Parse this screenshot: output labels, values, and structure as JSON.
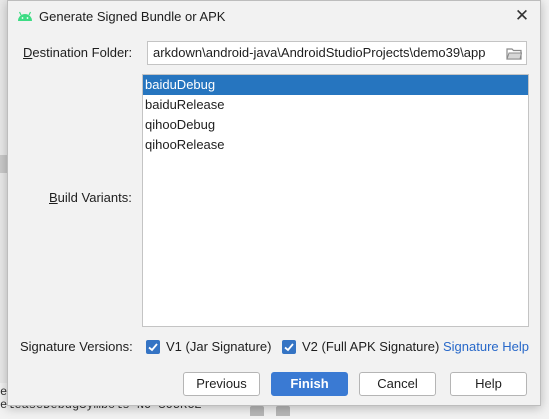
{
  "background": {
    "console_line_1": "e",
    "console_line_2": "eleaseDebugSymbols NO-SOURCE"
  },
  "dialog": {
    "title": "Generate Signed Bundle or APK",
    "close_label": "✕",
    "destination_label_mnemonic": "D",
    "destination_label_rest": "estination Folder:",
    "destination_value": "arkdown\\android-java\\AndroidStudioProjects\\demo39\\app",
    "build_variants_label_mnemonic": "B",
    "build_variants_label_rest": "uild Variants:",
    "variants": [
      {
        "label": "baiduDebug",
        "selected": true
      },
      {
        "label": "baiduRelease",
        "selected": false
      },
      {
        "label": "qihooDebug",
        "selected": false
      },
      {
        "label": "qihooRelease",
        "selected": false
      }
    ],
    "signature_versions_label": "Signature Versions:",
    "v1_label": "V1 (Jar Signature)",
    "v1_checked": true,
    "v2_label": "V2 (Full APK Signature)",
    "v2_checked": true,
    "signature_help_link": "Signature Help",
    "buttons": {
      "previous": "Previous",
      "finish": "Finish",
      "cancel": "Cancel",
      "help": "Help"
    },
    "colors": {
      "accent": "#3a7ad3",
      "selection": "#2675bf",
      "link": "#2768c9",
      "android_green": "#3ddc84"
    }
  }
}
